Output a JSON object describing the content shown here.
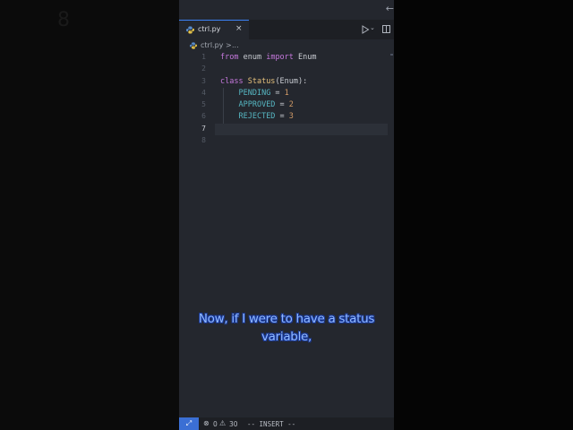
{
  "background": {
    "ghost_digit": "8"
  },
  "editor": {
    "tab": {
      "label": "ctrl.py",
      "close_glyph": "×",
      "icon": "python-icon"
    },
    "breadcrumb": {
      "file": "ctrl.py",
      "separator": ">",
      "rest": "..."
    },
    "toolbar": {
      "run": "play-icon",
      "run_options": "chevron-down-icon",
      "split": "split-editor-icon"
    },
    "back_arrow": "←",
    "code": [
      {
        "n": "1",
        "tokens": [
          {
            "t": "from",
            "c": "kw"
          },
          {
            "t": " enum ",
            "c": ""
          },
          {
            "t": "import",
            "c": "kw"
          },
          {
            "t": " Enum",
            "c": ""
          }
        ]
      },
      {
        "n": "2",
        "tokens": []
      },
      {
        "n": "3",
        "tokens": [
          {
            "t": "class",
            "c": "kw"
          },
          {
            "t": " ",
            "c": ""
          },
          {
            "t": "Status",
            "c": "cls"
          },
          {
            "t": "(Enum):",
            "c": ""
          }
        ]
      },
      {
        "n": "4",
        "tokens": [
          {
            "t": "    ",
            "c": ""
          },
          {
            "t": "PENDING",
            "c": "nm"
          },
          {
            "t": " = ",
            "c": ""
          },
          {
            "t": "1",
            "c": "num"
          }
        ]
      },
      {
        "n": "5",
        "tokens": [
          {
            "t": "    ",
            "c": ""
          },
          {
            "t": "APPROVED",
            "c": "nm"
          },
          {
            "t": " = ",
            "c": ""
          },
          {
            "t": "2",
            "c": "num"
          }
        ]
      },
      {
        "n": "6",
        "tokens": [
          {
            "t": "    ",
            "c": ""
          },
          {
            "t": "REJECTED",
            "c": "nm"
          },
          {
            "t": " = ",
            "c": ""
          },
          {
            "t": "3",
            "c": "num"
          }
        ]
      },
      {
        "n": "7",
        "tokens": [],
        "current": true
      },
      {
        "n": "8",
        "tokens": []
      }
    ]
  },
  "caption": {
    "line1": "Now, if I were to have a status",
    "line2": "variable,"
  },
  "statusbar": {
    "remote_glyph": "⤢",
    "errors": "0",
    "warnings": "30",
    "mode": "-- INSERT --"
  },
  "colors": {
    "accent": "#3b82f6",
    "keyword": "#c678dd",
    "class": "#e5c07b",
    "constant": "#56b6c2",
    "number": "#d19a66",
    "caption": "#8fb8ff"
  }
}
